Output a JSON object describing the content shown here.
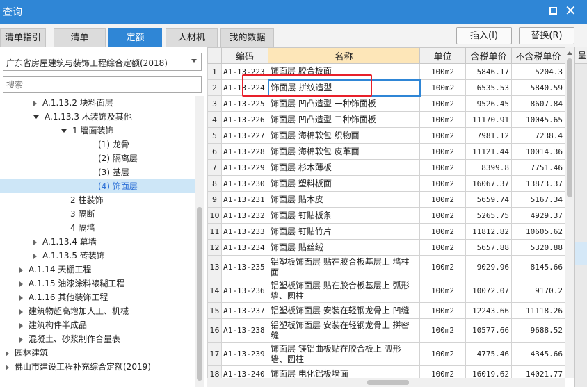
{
  "window": {
    "title": "查询"
  },
  "tabs": [
    {
      "label": "清单指引",
      "active": false
    },
    {
      "label": "清单",
      "active": false
    },
    {
      "label": "定额",
      "active": true
    },
    {
      "label": "人材机",
      "active": false
    },
    {
      "label": "我的数据",
      "active": false
    }
  ],
  "toolbar": {
    "insert_label": "插入(I)",
    "replace_label": "替换(R)"
  },
  "left": {
    "library": "广东省房屋建筑与装饰工程综合定额(2018)",
    "search_placeholder": "搜索",
    "tree": [
      {
        "label": "A.1.13.2 块料面层",
        "indent": 1,
        "expander": "right"
      },
      {
        "label": "A.1.13.3 木装饰及其他",
        "indent": 1,
        "expander": "down"
      },
      {
        "label": "1 墙面装饰",
        "indent": 2,
        "expander": "down"
      },
      {
        "label": "(1) 龙骨",
        "indent": 3,
        "expander": "none"
      },
      {
        "label": "(2) 隔离层",
        "indent": 3,
        "expander": "none"
      },
      {
        "label": "(3) 基层",
        "indent": 3,
        "expander": "none"
      },
      {
        "label": "(4) 饰面层",
        "indent": 3,
        "expander": "none",
        "selected": true
      },
      {
        "label": "2 柱装饰",
        "indent": 2,
        "expander": "none"
      },
      {
        "label": "3 隔断",
        "indent": 2,
        "expander": "none"
      },
      {
        "label": "4 隔墙",
        "indent": 2,
        "expander": "none"
      },
      {
        "label": "A.1.13.4 幕墙",
        "indent": 1,
        "expander": "right"
      },
      {
        "label": "A.1.13.5 砖装饰",
        "indent": 1,
        "expander": "right"
      },
      {
        "label": "A.1.14 天棚工程",
        "indent": 0.5,
        "expander": "right"
      },
      {
        "label": "A.1.15 油漆涂料裱糊工程",
        "indent": 0.5,
        "expander": "right"
      },
      {
        "label": "A.1.16 其他装饰工程",
        "indent": 0.5,
        "expander": "right"
      },
      {
        "label": "建筑物超高增加人工、机械",
        "indent": 0.5,
        "expander": "right"
      },
      {
        "label": "建筑构件半成品",
        "indent": 0.5,
        "expander": "right"
      },
      {
        "label": "混凝土、砂浆制作合量表",
        "indent": 0.5,
        "expander": "right"
      },
      {
        "label": "园林建筑",
        "indent": 0,
        "expander": "right"
      },
      {
        "label": "佛山市建设工程补充综合定额(2019)",
        "indent": 0,
        "expander": "right"
      }
    ]
  },
  "grid": {
    "columns": [
      "",
      "编码",
      "名称",
      "单位",
      "含税单价",
      "不含税单价"
    ],
    "rows": [
      {
        "idx": "1",
        "code": "A1-13-223",
        "name": "饰面层 胶合板面",
        "unit": "100m2",
        "tax": "5846.17",
        "notax": "5204.3"
      },
      {
        "idx": "2",
        "code": "A1-13-224",
        "name": "饰面层 拼纹造型",
        "unit": "100m2",
        "tax": "6535.53",
        "notax": "5840.59",
        "selected": true
      },
      {
        "idx": "3",
        "code": "A1-13-225",
        "name": "饰面层 凹凸造型 一种饰面板",
        "unit": "100m2",
        "tax": "9526.45",
        "notax": "8607.84"
      },
      {
        "idx": "4",
        "code": "A1-13-226",
        "name": "饰面层 凹凸造型 二种饰面板",
        "unit": "100m2",
        "tax": "11170.91",
        "notax": "10045.65"
      },
      {
        "idx": "5",
        "code": "A1-13-227",
        "name": "饰面层 海棉软包 织物面",
        "unit": "100m2",
        "tax": "7981.12",
        "notax": "7238.4"
      },
      {
        "idx": "6",
        "code": "A1-13-228",
        "name": "饰面层 海棉软包 皮革面",
        "unit": "100m2",
        "tax": "11121.44",
        "notax": "10014.36"
      },
      {
        "idx": "7",
        "code": "A1-13-229",
        "name": "饰面层 杉木薄板",
        "unit": "100m2",
        "tax": "8399.8",
        "notax": "7751.46"
      },
      {
        "idx": "8",
        "code": "A1-13-230",
        "name": "饰面层 塑料板面",
        "unit": "100m2",
        "tax": "16067.37",
        "notax": "13873.37"
      },
      {
        "idx": "9",
        "code": "A1-13-231",
        "name": "饰面层 贴木皮",
        "unit": "100m2",
        "tax": "5659.74",
        "notax": "5167.34"
      },
      {
        "idx": "10",
        "code": "A1-13-232",
        "name": "饰面层 钉贴板条",
        "unit": "100m2",
        "tax": "5265.75",
        "notax": "4929.37"
      },
      {
        "idx": "11",
        "code": "A1-13-233",
        "name": "饰面层 钉贴竹片",
        "unit": "100m2",
        "tax": "11812.82",
        "notax": "10605.62"
      },
      {
        "idx": "12",
        "code": "A1-13-234",
        "name": "饰面层 贴丝绒",
        "unit": "100m2",
        "tax": "5657.88",
        "notax": "5320.88"
      },
      {
        "idx": "13",
        "code": "A1-13-235",
        "name": "铝塑板饰面层 贴在胶合板基层上 墙柱面",
        "unit": "100m2",
        "tax": "9029.96",
        "notax": "8145.66",
        "tall": true
      },
      {
        "idx": "14",
        "code": "A1-13-236",
        "name": "铝塑板饰面层 贴在胶合板基层上 弧形墙、圆柱",
        "unit": "100m2",
        "tax": "10072.07",
        "notax": "9170.2",
        "tall": true
      },
      {
        "idx": "15",
        "code": "A1-13-237",
        "name": "铝塑板饰面层 安装在轻钢龙骨上 凹缝",
        "unit": "100m2",
        "tax": "12243.66",
        "notax": "11118.26"
      },
      {
        "idx": "16",
        "code": "A1-13-238",
        "name": "铝塑板饰面层 安装在轻钢龙骨上 拼密缝",
        "unit": "100m2",
        "tax": "10577.66",
        "notax": "9688.52",
        "tall": true
      },
      {
        "idx": "17",
        "code": "A1-13-239",
        "name": "饰面层 镁铝曲板贴在胶合板上 弧形墙、圆柱",
        "unit": "100m2",
        "tax": "4775.46",
        "notax": "4345.66",
        "tall": true
      },
      {
        "idx": "18",
        "code": "A1-13-240",
        "name": "饰面层 电化铝板墙面",
        "unit": "100m2",
        "tax": "16019.62",
        "notax": "14021.77"
      }
    ]
  },
  "edge_panel": {
    "header": "呈"
  },
  "colors": {
    "accent": "#2f86d6",
    "highlight": "#e8202a",
    "name_header": "#fde6b8"
  }
}
